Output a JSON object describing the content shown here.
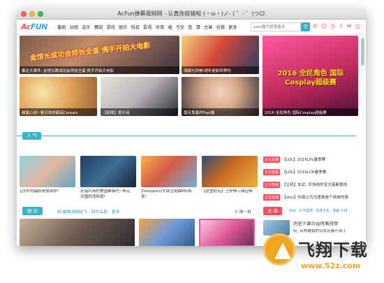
{
  "window": {
    "title": "AcFun弹幕视频网 - 认真你就输啦 (・ω・)ノ- ( ゜- ゜)つロ"
  },
  "navbar": {
    "logo_main": "Ac",
    "logo_sub": "FUN",
    "links": [
      "番剧",
      "动画",
      "音乐",
      "舞蹈",
      "游戏",
      "娱乐",
      "科技",
      "影视",
      "体育",
      "彧",
      "弓女",
      "鱼",
      "谭",
      "文章",
      "合辑",
      "更多"
    ],
    "search_placeholder": "papi酱力挺鬼畜全",
    "search_icon": "search-icon",
    "tool_icons": [
      "phone-icon",
      "user-icon",
      "history-icon",
      "upload-icon",
      "message-icon",
      "folder-icon"
    ]
  },
  "banner": {
    "tiles": [
      {
        "caption": "暴走大事件: 金馆长跳成功会师张全蛋 携手开拍大电影",
        "headline": "金馆长成功会师张全蛋 携手开拍大电影"
      },
      {
        "caption": "海贼与剑神·明年是新世界吗",
        "headline": ""
      },
      {
        "caption": "2016 全民角色 国际Cosplay超级赛",
        "headline": "2016 全民角色 国际Cosplay超级赛"
      },
      {
        "caption": "甜蜜心谷? 看日本的甜品Cereals",
        "headline": ""
      },
      {
        "caption": "【封面】爱の诗",
        "headline": ""
      },
      {
        "caption": "毫无鬼畜的Papi酱",
        "headline": ""
      },
      {
        "caption": "没元之间的异世界夜生",
        "headline": ""
      }
    ]
  },
  "popular": {
    "label": "人 气",
    "videos": [
      {
        "title": "让5岁的福原爱萌哭你!"
      },
      {
        "title": "走错片场的美国赛事代! 再见, 天国的违和感!"
      },
      {
        "title": "Zootopia日文版主题曲MV首发!"
      },
      {
        "title": "【这鱼好玩】王师傅三鼎佳味"
      }
    ],
    "live": [
      {
        "badge": "正在直播",
        "text": "【LOL】2016LPL春季赛"
      },
      {
        "badge": "正在直播",
        "text": "【LOL】2016LCK春季赛"
      },
      {
        "badge": "正在直播",
        "text": "【主机】女武: 农场线的宝大富都爱他"
      },
      {
        "badge": "正在直播",
        "text": "【wiiu】你真以为马里奥是个简单的游"
      }
    ]
  },
  "entertainment": {
    "label": "娱 乐",
    "tabs": [
      "AC春晚战舰起飞",
      "四大名助",
      "更多"
    ],
    "change_label": "换一批"
  },
  "articles": {
    "label": "文 章",
    "tabs": [
      "综合",
      "工作情感",
      "动漫文化",
      "漫画·小说"
    ],
    "items": [
      {
        "title": "历史②课の站得离得惨"
      },
      {
        "title": "哎, 突然被我的日式花板吓到了"
      }
    ]
  },
  "watermark": {
    "title": "飞翔下载",
    "url": "www.52z.com"
  }
}
